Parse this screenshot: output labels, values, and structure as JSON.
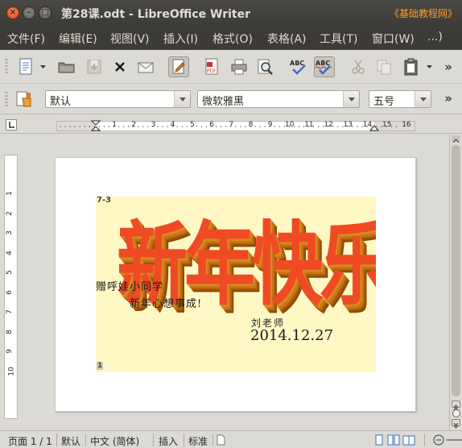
{
  "window": {
    "title": "第28课.odt - LibreOffice Writer",
    "watermark": "《基础教程网》"
  },
  "menu": [
    "文件(F)",
    "编辑(E)",
    "视图(V)",
    "插入(I)",
    "格式(O)",
    "表格(A)",
    "工具(T)",
    "窗口(W)",
    "...)"
  ],
  "toolbar": {
    "overflow_label": "»",
    "paragraph_style": "默认",
    "font_name": "微软雅黑",
    "font_size": "五号"
  },
  "ruler": {
    "h_marks": [
      "1",
      "2",
      "3",
      "4",
      "5",
      "6",
      "7",
      "8",
      "9",
      "10",
      "11",
      "12",
      "13",
      "14",
      "15",
      "16"
    ],
    "v_marks": [
      "1",
      "2",
      "3",
      "4",
      "5",
      "6",
      "7",
      "8",
      "9",
      "10"
    ]
  },
  "document": {
    "corner_label": "7-3",
    "big_title": "新年快乐",
    "greeting_line1": "赠呼娃小同学",
    "greeting_line2": "新年心想事成!",
    "signature": "刘老师",
    "date": "2014.12.27",
    "anchor_label": "1"
  },
  "status": {
    "page": "页面 1 / 1",
    "style": "默认",
    "language": "中文 (简体)",
    "insert_mode": "插入",
    "selection_mode": "标准"
  }
}
